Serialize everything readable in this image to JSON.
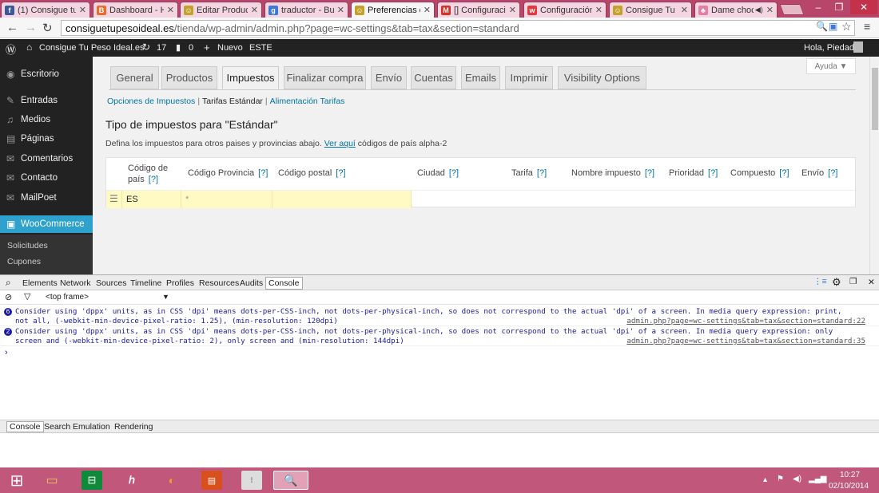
{
  "browser": {
    "tabs": [
      {
        "title": "(1) Consigue tu",
        "fav_color": "#3b5998",
        "fav_glyph": "f"
      },
      {
        "title": "Dashboard - H",
        "fav_color": "#e76f2d",
        "fav_glyph": "B"
      },
      {
        "title": "Editar Product",
        "fav_color": "#c2a22a",
        "fav_glyph": "☺"
      },
      {
        "title": "traductor - Bus",
        "fav_color": "#3b78d8",
        "fav_glyph": "g"
      },
      {
        "title": "Preferencias de",
        "fav_color": "#c2a22a",
        "fav_glyph": "☺"
      },
      {
        "title": "[] Configuració",
        "fav_color": "#d93025",
        "fav_glyph": "M"
      },
      {
        "title": "Configuración",
        "fav_color": "#e3383d",
        "fav_glyph": "w"
      },
      {
        "title": "Consigue Tu P",
        "fav_color": "#c2a22a",
        "fav_glyph": "☺"
      },
      {
        "title": "Dame choc",
        "fav_color": "#e37fa5",
        "fav_glyph": "♣"
      }
    ],
    "active_tab": 4,
    "url_host": "consiguetupesoideal.es",
    "url_path": "/tienda/wp-admin/admin.php?page=wc-settings&tab=tax&section=standard"
  },
  "adminbar": {
    "site": "Consigue Tu Peso Ideal.es",
    "updates": "17",
    "comments": "0",
    "new": "Nuevo",
    "extra": "ESTE",
    "greeting": "Hola, Piedad"
  },
  "sidebar": {
    "items": [
      {
        "label": "Escritorio",
        "icon": "dashboard-icon",
        "glyph": "◉"
      },
      {
        "label": "Entradas",
        "icon": "pin-icon",
        "glyph": "✎"
      },
      {
        "label": "Medios",
        "icon": "media-icon",
        "glyph": "♫"
      },
      {
        "label": "Páginas",
        "icon": "pages-icon",
        "glyph": "▤"
      },
      {
        "label": "Comentarios",
        "icon": "comments-icon",
        "glyph": "✉"
      },
      {
        "label": "Contacto",
        "icon": "contact-icon",
        "glyph": "✉"
      },
      {
        "label": "MailPoet",
        "icon": "mailpoet-icon",
        "glyph": "✉"
      },
      {
        "label": "WooCommerce",
        "icon": "woocommerce-icon",
        "glyph": "▣"
      }
    ],
    "sub": [
      "Solicitudes",
      "Cupones"
    ]
  },
  "main": {
    "help": "Ayuda ▼",
    "tabs": [
      "General",
      "Productos",
      "Impuestos",
      "Finalizar compra",
      "Envío",
      "Cuentas",
      "Emails",
      "Imprimir",
      "Visibility Options"
    ],
    "active_tab": 2,
    "subnav": [
      "Opciones de Impuestos",
      "Tarifas Estándar",
      "Alimentación Tarifas"
    ],
    "subnav_sep": "|",
    "title": "Tipo de impuestos para \"Estándar\"",
    "desc_before": "Defina los impuestos para otros paises y provincias abajo.",
    "desc_link": "Ver aquí",
    "desc_after": "códigos de país alpha-2",
    "columns": [
      {
        "label": "Código de país",
        "line1": "Código de",
        "line2": "país",
        "q": "[?]"
      },
      {
        "label": "Código Provincia",
        "q": "[?]"
      },
      {
        "label": "Código postal",
        "q": "[?]"
      },
      {
        "label": "Ciudad",
        "q": "[?]"
      },
      {
        "label": "Tarifa",
        "q": "[?]"
      },
      {
        "label": "Nombre impuesto",
        "q": "[?]"
      },
      {
        "label": "Prioridad",
        "q": "[?]"
      },
      {
        "label": "Compuesto",
        "q": "[?]"
      },
      {
        "label": "Envío",
        "q": "[?]"
      }
    ],
    "row": {
      "country": "ES",
      "state": "*",
      "postcode": ""
    }
  },
  "devtools": {
    "tabs": [
      "Elements",
      "Network",
      "Sources",
      "Timeline",
      "Profiles",
      "Resources",
      "Audits",
      "Console"
    ],
    "active": "Console",
    "frame": "<top frame>",
    "messages": [
      {
        "count": "6",
        "text": "Consider using 'dppx' units, as in CSS 'dpi' means dots-per-CSS-inch, not dots-per-physical-inch, so does not correspond to the actual 'dpi' of a screen. In media query expression: print,\nnot all, (-webkit-min-device-pixel-ratio: 1.25), (min-resolution: 120dpi)",
        "source": "admin.php?page=wc-settings&tab=tax&section=standard:22"
      },
      {
        "count": "2",
        "text": "Consider using 'dppx' units, as in CSS 'dpi' means dots-per-CSS-inch, not dots-per-physical-inch, so does not correspond to the actual 'dpi' of a screen. In media query expression: only\nscreen and (-webkit-min-device-pixel-ratio: 2), only screen and (min-resolution: 144dpi)",
        "source": "admin.php?page=wc-settings&tab=tax&section=standard:35"
      }
    ],
    "prompt": "›",
    "drawer": [
      "Console",
      "Search",
      "Emulation",
      "Rendering"
    ]
  },
  "taskbar": {
    "time": "10:27",
    "date": "02/10/2014"
  }
}
